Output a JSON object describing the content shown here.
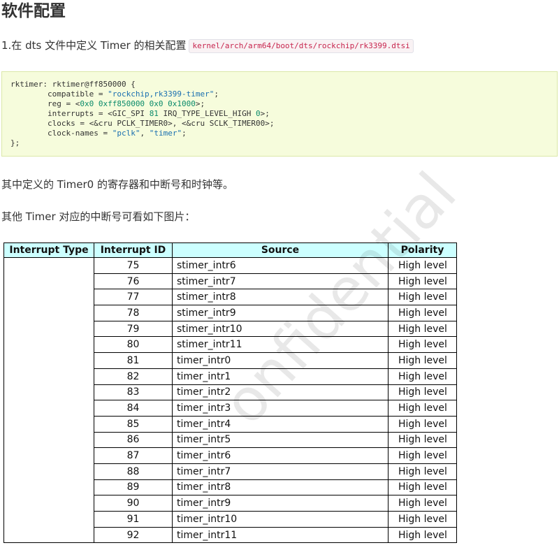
{
  "heading": "软件配置",
  "step1": {
    "text": "1.在 dts 文件中定义 Timer 的相关配置",
    "path": "kernel/arch/arm64/boot/dts/rockchip/rk3399.dtsi"
  },
  "code": {
    "l1": "rktimer: rktimer@ff850000 {",
    "l2a": "        compatible = ",
    "l2s": "\"rockchip,rk3399-timer\"",
    "l2b": ";",
    "l3a": "        reg = <",
    "l3n": "0x0 0xff850000 0x0 0x1000",
    "l3b": ">;",
    "l4a": "        interrupts = <GIC_SPI ",
    "l4n1": "81",
    "l4m": " IRQ_TYPE_LEVEL_HIGH ",
    "l4n2": "0",
    "l4b": ">;",
    "l5": "        clocks = <&cru PCLK_TIMER0>, <&cru SCLK_TIMER00>;",
    "l6a": "        clock-names = ",
    "l6s1": "\"pclk\"",
    "l6m": ", ",
    "l6s2": "\"timer\"",
    "l6b": ";",
    "l7": "};"
  },
  "para1": "其中定义的 Timer0 的寄存器和中断号和时钟等。",
  "para2": "其他 Timer 对应的中断号可看如下图片：",
  "table": {
    "headers": [
      "Interrupt Type",
      "Interrupt ID",
      "Source",
      "Polarity"
    ],
    "rows": [
      {
        "id": "75",
        "source": "stimer_intr6",
        "polarity": "High level"
      },
      {
        "id": "76",
        "source": "stimer_intr7",
        "polarity": "High level"
      },
      {
        "id": "77",
        "source": "stimer_intr8",
        "polarity": "High level"
      },
      {
        "id": "78",
        "source": "stimer_intr9",
        "polarity": "High level"
      },
      {
        "id": "79",
        "source": "stimer_intr10",
        "polarity": "High level"
      },
      {
        "id": "80",
        "source": "stimer_intr11",
        "polarity": "High level"
      },
      {
        "id": "81",
        "source": "timer_intr0",
        "polarity": "High level"
      },
      {
        "id": "82",
        "source": "timer_intr1",
        "polarity": "High level"
      },
      {
        "id": "83",
        "source": "timer_intr2",
        "polarity": "High level"
      },
      {
        "id": "84",
        "source": "timer_intr3",
        "polarity": "High level"
      },
      {
        "id": "85",
        "source": "timer_intr4",
        "polarity": "High level"
      },
      {
        "id": "86",
        "source": "timer_intr5",
        "polarity": "High level"
      },
      {
        "id": "87",
        "source": "timer_intr6",
        "polarity": "High level"
      },
      {
        "id": "88",
        "source": "timer_intr7",
        "polarity": "High level"
      },
      {
        "id": "89",
        "source": "timer_intr8",
        "polarity": "High level"
      },
      {
        "id": "90",
        "source": "timer_intr9",
        "polarity": "High level"
      },
      {
        "id": "91",
        "source": "timer_intr10",
        "polarity": "High level"
      },
      {
        "id": "92",
        "source": "timer_intr11",
        "polarity": "High level"
      }
    ]
  },
  "watermark": "onfidential",
  "colors": {
    "header_bg": "#ccffff",
    "code_bg": "#f6fcdc",
    "path_text": "#c7254e"
  }
}
